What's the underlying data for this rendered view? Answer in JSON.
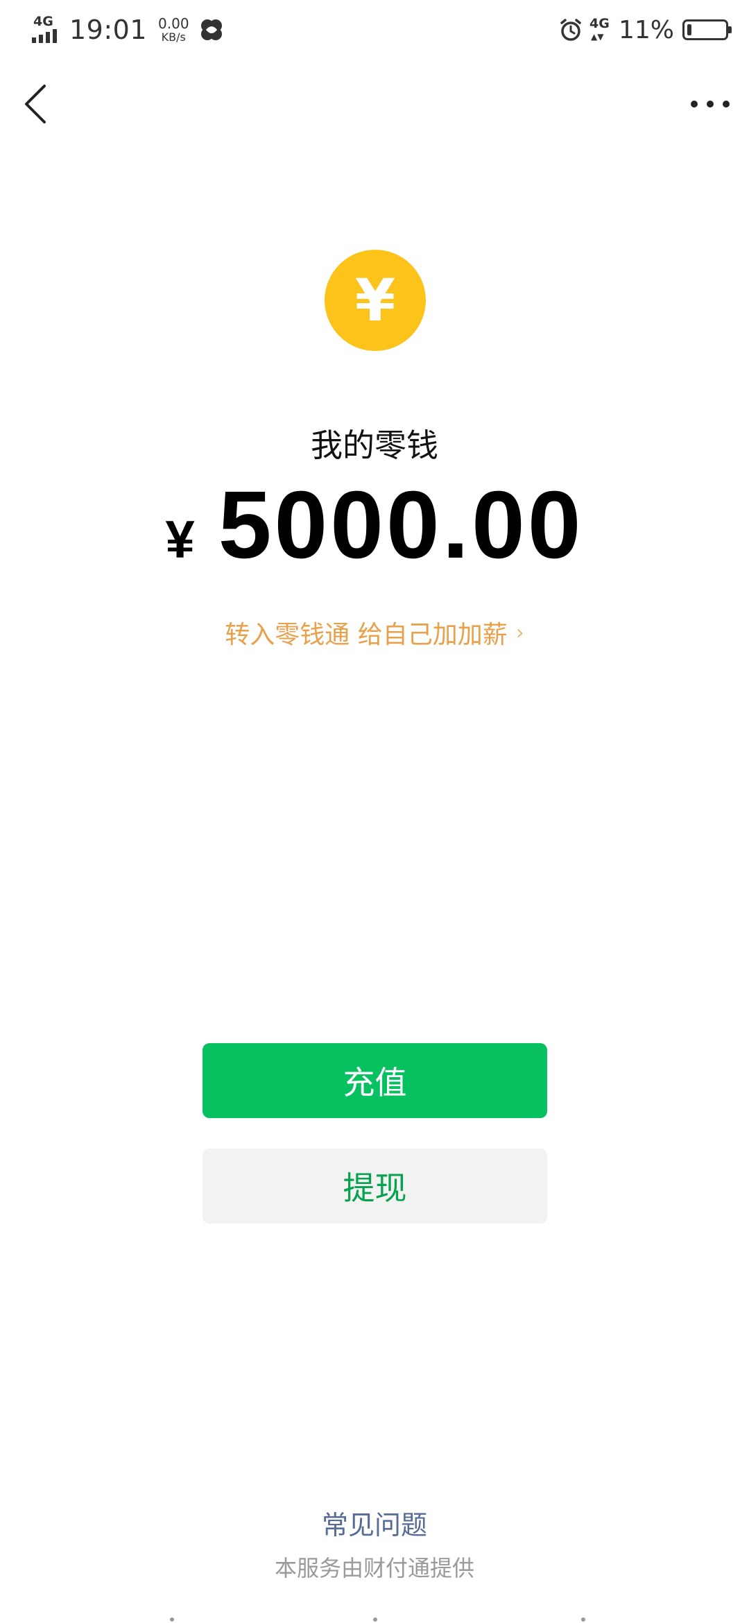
{
  "status_bar": {
    "network_left": "4G",
    "time": "19:01",
    "speed_value": "0.00",
    "speed_unit": "KB/s",
    "network_right": "4G",
    "battery_percent": "11%",
    "battery_level": 0.11
  },
  "nav": {
    "back_icon": "chevron-left-icon",
    "more_icon": "more-dots-icon"
  },
  "wallet": {
    "coin_symbol": "¥",
    "title": "我的零钱",
    "currency": "¥",
    "amount": "5000.00",
    "promo_text": "转入零钱通 给自己加加薪",
    "promo_chevron": "›"
  },
  "actions": {
    "recharge_label": "充值",
    "withdraw_label": "提现"
  },
  "footer": {
    "faq_label": "常见问题",
    "provider_text": "本服务由财付通提供"
  },
  "colors": {
    "coin": "#fcc31a",
    "primary_green": "#07c160",
    "promo_orange": "#e8a04b",
    "link_blue": "#576b95"
  }
}
